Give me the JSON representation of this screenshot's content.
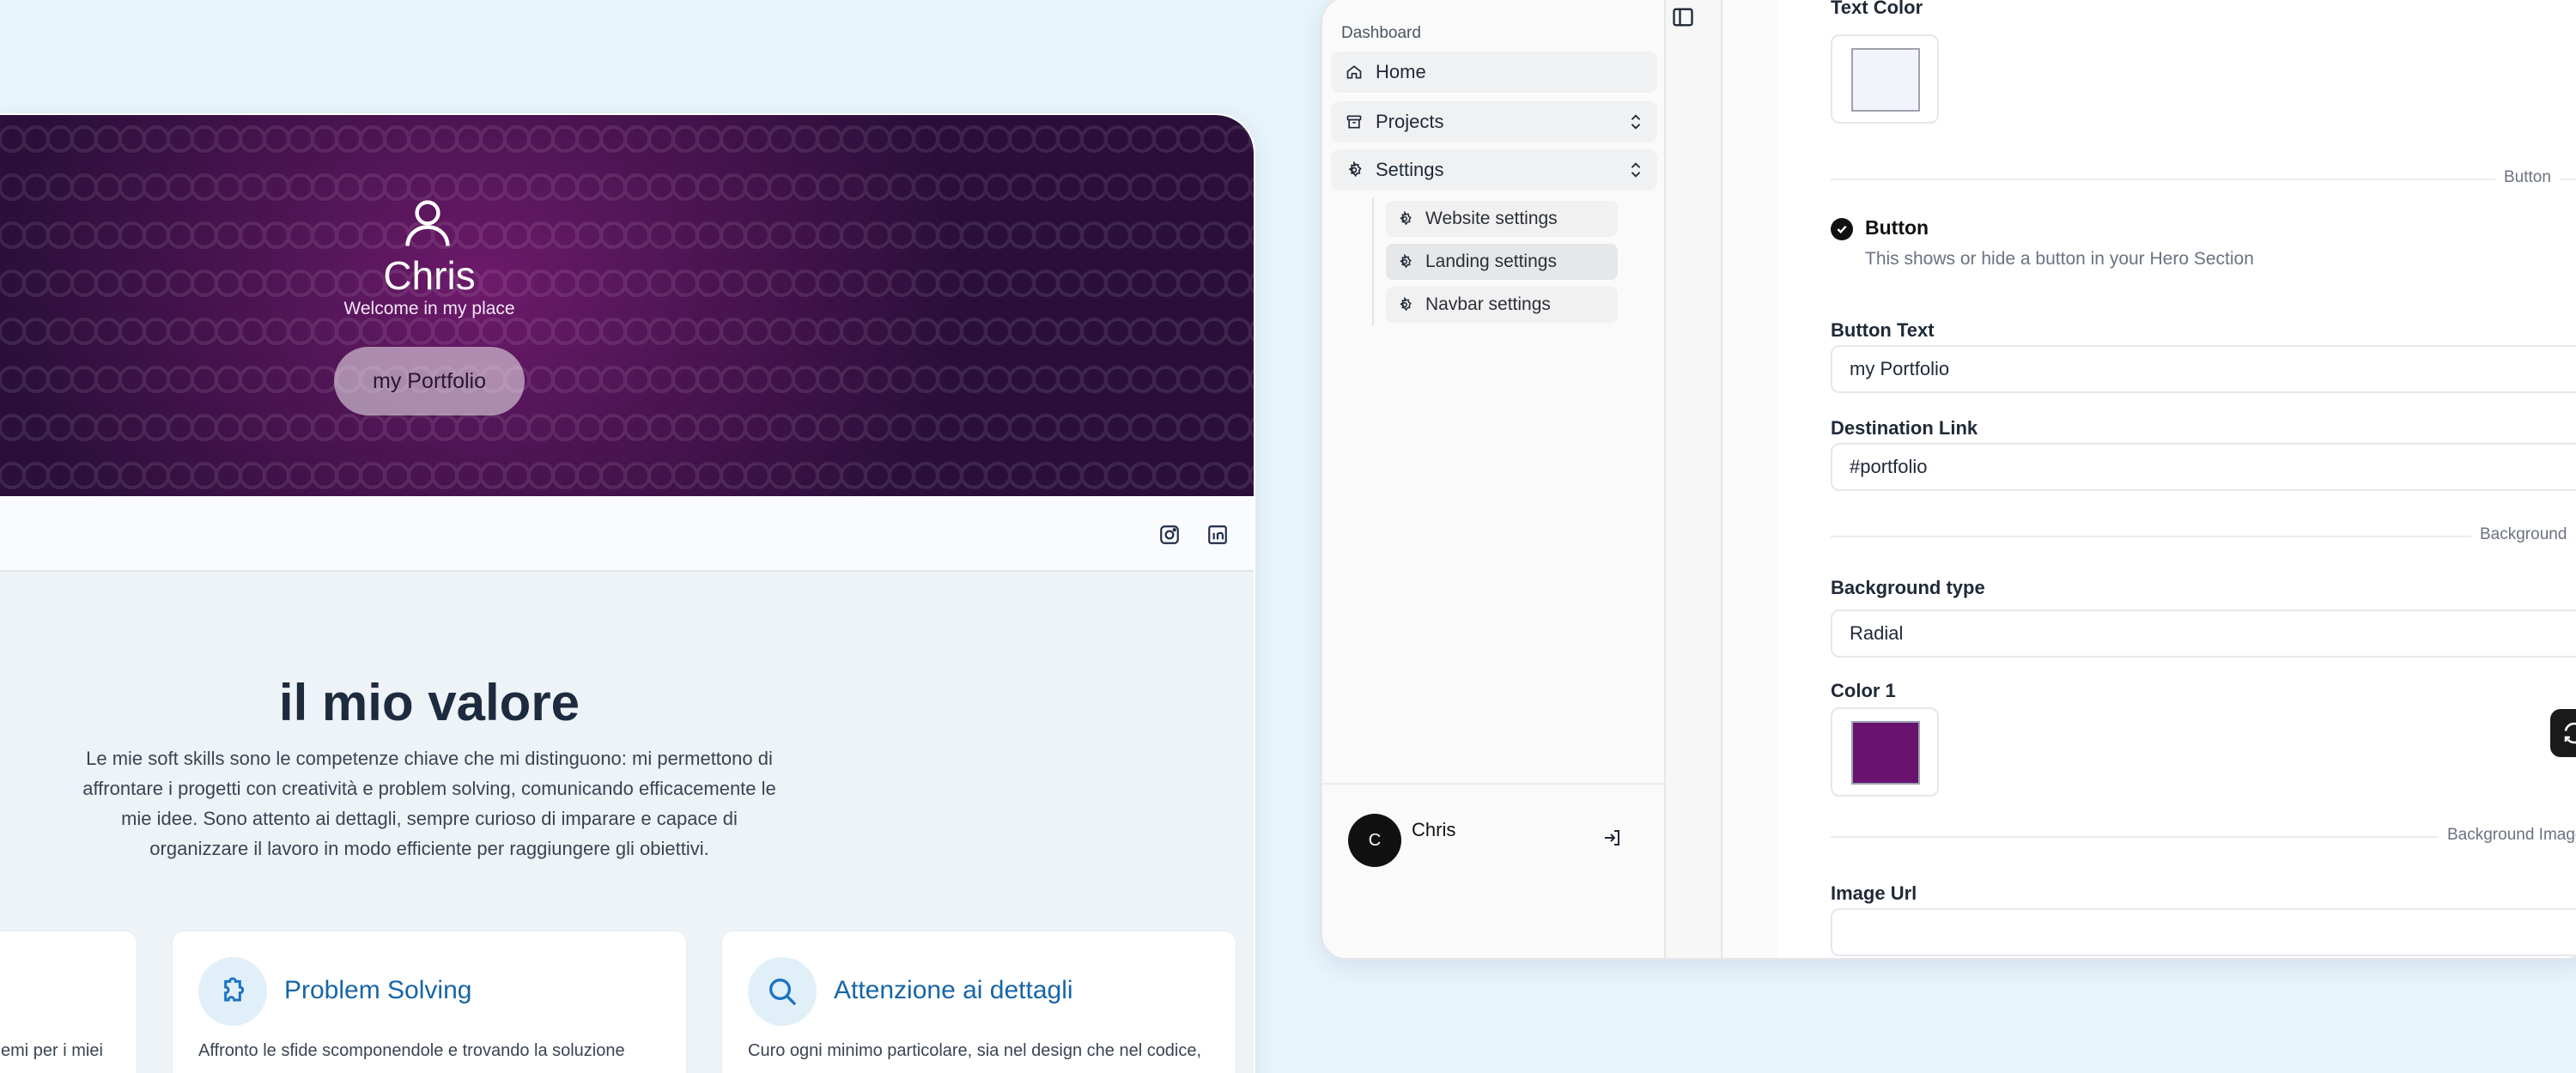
{
  "preview": {
    "hero": {
      "name": "Chris",
      "subtitle": "Welcome in my place",
      "button_label": "my Portfolio",
      "icon": "user-icon",
      "background": {
        "type": "radial",
        "color_center": "#6d1a6b",
        "color_outer": "#2b0f3a"
      }
    },
    "navbar": {
      "icons": [
        "instagram-icon",
        "linkedin-icon"
      ]
    },
    "values": {
      "title": "il mio valore",
      "lines": [
        "Le mie soft skills sono le competenze chiave che mi distinguono: mi permettono di",
        "affrontare i progetti con creatività e problem solving, comunicando efficacemente le",
        "mie idee. Sono attento ai dettagli, sempre curioso di imparare e capace di",
        "organizzare il lavoro in modo efficiente per raggiungere gli obiettivi."
      ]
    },
    "cards": [
      {
        "title": "",
        "text": "emi per i miei",
        "icon": ""
      },
      {
        "title": "Problem Solving",
        "text": "Affronto le sfide scomponendole e trovando la soluzione",
        "icon": "puzzle-icon"
      },
      {
        "title": "Attenzione ai dettagli",
        "text": "Curo ogni minimo particolare, sia nel design che nel codice,",
        "icon": "search-icon"
      }
    ]
  },
  "sidebar": {
    "group_label": "Dashboard",
    "items": [
      {
        "label": "Home",
        "icon": "home-icon"
      },
      {
        "label": "Projects",
        "icon": "archive-icon"
      },
      {
        "label": "Settings",
        "icon": "gear-icon"
      }
    ],
    "settings_sub": [
      {
        "label": "Website settings",
        "icon": "gear-icon"
      },
      {
        "label": "Landing settings",
        "icon": "gear-icon"
      },
      {
        "label": "Navbar settings",
        "icon": "gear-icon"
      }
    ],
    "user": {
      "initial": "C",
      "name": "Chris"
    }
  },
  "form": {
    "text_color_label": "Text Color",
    "text_color_value": "#f3f4fb",
    "button_section": "Button",
    "button_toggle": {
      "label": "Button",
      "description": "This shows or hide a button in your Hero Section",
      "checked": true
    },
    "button_text": {
      "label": "Button Text",
      "value": "my Portfolio"
    },
    "destination_link": {
      "label": "Destination Link",
      "value": "#portfolio"
    },
    "background_section": "Background",
    "background_type": {
      "label": "Background type",
      "value": "Radial"
    },
    "color1": {
      "label": "Color 1",
      "value": "#6a136e"
    },
    "background_image_section": "Background Image",
    "image_url": {
      "label": "Image Url",
      "value": ""
    }
  }
}
